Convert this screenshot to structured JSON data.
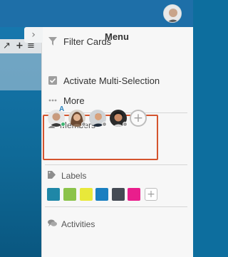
{
  "menu": {
    "title": "Menu",
    "items": [
      {
        "label": "Filter Cards",
        "icon": "filter-icon"
      },
      {
        "label": "Activate Multi-Selection",
        "icon": "checkbox-icon"
      },
      {
        "label": "More",
        "icon": "ellipsis-icon"
      }
    ]
  },
  "members": {
    "heading": "Members",
    "admin_badge": "A",
    "people": [
      {
        "icon": "member-avatar",
        "status_color": "#3cb371"
      },
      {
        "icon": "member-avatar",
        "status_color": "#9e9e9e"
      },
      {
        "icon": "member-avatar",
        "status_color": "#9e9e9e"
      },
      {
        "icon": "member-avatar",
        "status_color": "#9e9e9e"
      }
    ],
    "add_symbol": "+"
  },
  "labels": {
    "heading": "Labels",
    "colors": [
      "#1f87a7",
      "#8bc34a",
      "#e8e83a",
      "#1a7fc0",
      "#454b54",
      "#e91e8c"
    ],
    "add_symbol": "+"
  },
  "activities": {
    "heading": "Activities"
  },
  "board": {
    "toolbar_icons": [
      "↗",
      "+",
      "≡"
    ],
    "collapse_symbol": "›"
  },
  "colors": {
    "accent_highlight": "#d4542e",
    "header": "#1e6fa8",
    "panel": "#f7f7f7"
  }
}
